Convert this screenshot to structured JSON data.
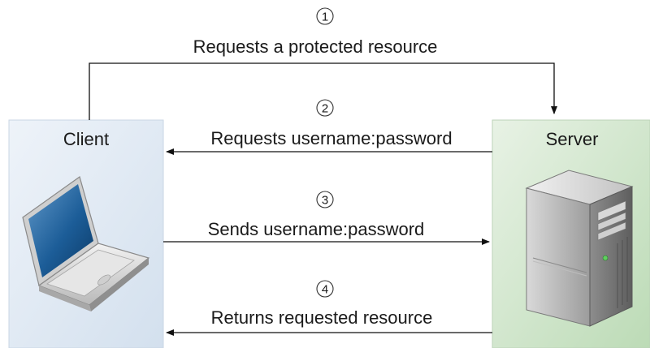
{
  "client": {
    "label": "Client"
  },
  "server": {
    "label": "Server"
  },
  "steps": [
    {
      "number": "1",
      "label": "Requests a protected resource",
      "direction": "client-to-server"
    },
    {
      "number": "2",
      "label": "Requests username:password",
      "direction": "server-to-client"
    },
    {
      "number": "3",
      "label": "Sends username:password",
      "direction": "client-to-server"
    },
    {
      "number": "4",
      "label": "Returns requested resource",
      "direction": "server-to-client"
    }
  ],
  "colors": {
    "client_panel_top": "#e9f0f8",
    "client_panel_bottom": "#d7e3f0",
    "server_panel_top": "#e3efe0",
    "server_panel_bottom": "#c4dfc0",
    "line": "#111111"
  }
}
